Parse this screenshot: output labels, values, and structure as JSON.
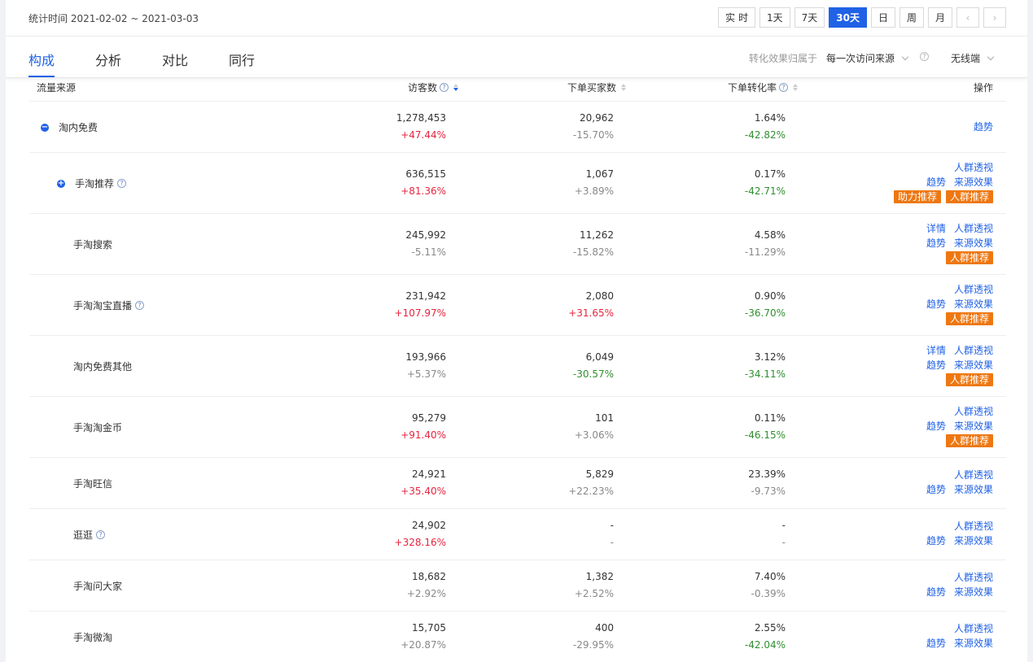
{
  "header": {
    "stat_time": "统计时间 2021-02-02 ~ 2021-03-03",
    "ranges": [
      "实 时",
      "1天",
      "7天",
      "30天",
      "日",
      "周",
      "月"
    ],
    "active_range": "30天",
    "prev": "‹",
    "next": "›"
  },
  "tabs": [
    "构成",
    "分析",
    "对比",
    "同行"
  ],
  "active_tab": "构成",
  "attribution": {
    "label": "转化效果归属于",
    "value": "每一次访问来源",
    "help": "?",
    "device": "无线端"
  },
  "columns": {
    "source": "流量来源",
    "visitors": "访客数",
    "buyers": "下单买家数",
    "rate": "下单转化率",
    "ops": "操作"
  },
  "rows": [
    {
      "name": "淘内免费",
      "v1": "1,278,453",
      "d1": "+47.44%",
      "v2": "20,962",
      "d2": "-15.70%",
      "v3": "1.64%",
      "d3": "-42.82%"
    },
    {
      "name": "手淘推荐",
      "v1": "636,515",
      "d1": "+81.36%",
      "v2": "1,067",
      "d2": "+3.89%",
      "v3": "0.17%",
      "d3": "-42.71%"
    },
    {
      "name": "手淘搜索",
      "v1": "245,992",
      "d1": "-5.11%",
      "v2": "11,262",
      "d2": "-15.82%",
      "v3": "4.58%",
      "d3": "-11.29%"
    },
    {
      "name": "手淘淘宝直播",
      "v1": "231,942",
      "d1": "+107.97%",
      "v2": "2,080",
      "d2": "+31.65%",
      "v3": "0.90%",
      "d3": "-36.70%"
    },
    {
      "name": "淘内免费其他",
      "v1": "193,966",
      "d1": "+5.37%",
      "v2": "6,049",
      "d2": "-30.57%",
      "v3": "3.12%",
      "d3": "-34.11%"
    },
    {
      "name": "手淘淘金币",
      "v1": "95,279",
      "d1": "+91.40%",
      "v2": "101",
      "d2": "+3.06%",
      "v3": "0.11%",
      "d3": "-46.15%"
    },
    {
      "name": "手淘旺信",
      "v1": "24,921",
      "d1": "+35.40%",
      "v2": "5,829",
      "d2": "+22.23%",
      "v3": "23.39%",
      "d3": "-9.73%"
    },
    {
      "name": "逛逛",
      "v1": "24,902",
      "d1": "+328.16%",
      "v2": "-",
      "d2": "-",
      "v3": "-",
      "d3": "-"
    },
    {
      "name": "手淘问大家",
      "v1": "18,682",
      "d1": "+2.92%",
      "v2": "1,382",
      "d2": "+2.52%",
      "v3": "7.40%",
      "d3": "-0.39%"
    },
    {
      "name": "手淘微淘",
      "v1": "15,705",
      "d1": "+20.87%",
      "v2": "400",
      "d2": "-29.95%",
      "v3": "2.55%",
      "d3": "-42.04%"
    }
  ],
  "ops": {
    "trend": "趋势",
    "crowd_view": "人群透视",
    "source_effect": "来源效果",
    "detail": "详情",
    "boost": "助力推荐",
    "crowd_rec": "人群推荐"
  },
  "colors": {
    "accent": "#2062e6",
    "up": "#e8243f",
    "down": "#2f8f2f",
    "tag": "#ee7711"
  }
}
